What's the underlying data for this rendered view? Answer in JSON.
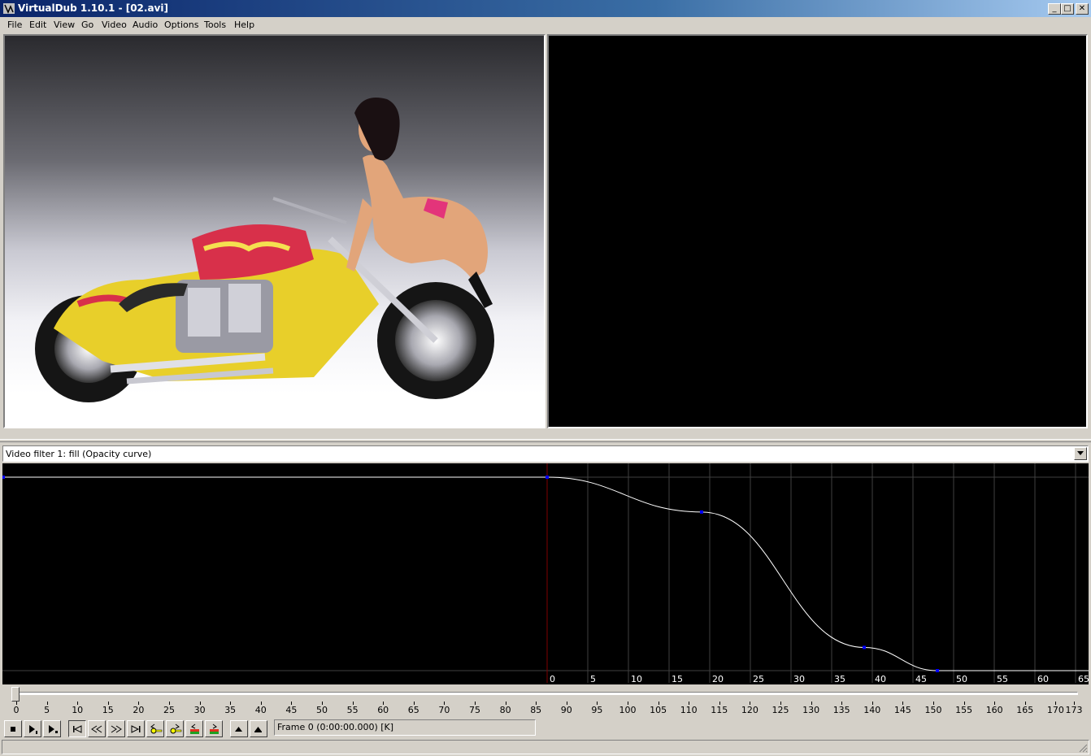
{
  "window": {
    "title": "VirtualDub 1.10.1 - [02.avi]",
    "minimize_glyph": "_",
    "maximize_glyph": "□",
    "close_glyph": "✕"
  },
  "menu": {
    "items": [
      {
        "label": "File"
      },
      {
        "label": "Edit"
      },
      {
        "label": "View"
      },
      {
        "label": "Go"
      },
      {
        "label": "Video"
      },
      {
        "label": "Audio"
      },
      {
        "label": "Options"
      },
      {
        "label": "Tools"
      },
      {
        "label": "Help"
      }
    ]
  },
  "panes": {
    "input_image": "motorcycle-photo",
    "output": "blank"
  },
  "filter_selector": {
    "value": "Video filter 1: fill (Opacity curve)",
    "dropdown_icon": "chevron-down-icon"
  },
  "curve_editor": {
    "frame_labels": [
      "0",
      "5",
      "10",
      "15",
      "20",
      "25",
      "30",
      "35",
      "40",
      "45",
      "50",
      "55",
      "60",
      "65"
    ],
    "keyframes": [
      {
        "frame": 0,
        "value": 1.0
      },
      {
        "frame": 19,
        "value": 0.82
      },
      {
        "frame": 39,
        "value": 0.12
      },
      {
        "frame": 48,
        "value": 0.0
      }
    ],
    "colors": {
      "curve": "#ffffff",
      "point": "#0000ff",
      "current_frame_line": "#800000",
      "grid": "#404040"
    }
  },
  "timeline": {
    "labels": [
      "0",
      "5",
      "10",
      "15",
      "20",
      "25",
      "30",
      "35",
      "40",
      "45",
      "50",
      "55",
      "60",
      "65",
      "70",
      "75",
      "80",
      "85",
      "90",
      "95",
      "100",
      "105",
      "110",
      "115",
      "120",
      "125",
      "130",
      "135",
      "140",
      "145",
      "150",
      "155",
      "160",
      "165",
      "170",
      "173"
    ],
    "current_position": 0
  },
  "toolbar": {
    "buttons": [
      {
        "name": "stop-icon"
      },
      {
        "name": "play-input-icon"
      },
      {
        "name": "play-output-icon"
      },
      {
        "name": "go-start-icon"
      },
      {
        "name": "prev-frame-icon"
      },
      {
        "name": "next-frame-icon"
      },
      {
        "name": "go-end-icon"
      },
      {
        "name": "prev-key-icon"
      },
      {
        "name": "next-key-icon"
      },
      {
        "name": "prev-scene-icon"
      },
      {
        "name": "next-scene-icon"
      },
      {
        "name": "mark-in-icon"
      },
      {
        "name": "mark-out-icon"
      }
    ],
    "frame_status": "Frame 0 (0:00:00.000) [K]"
  }
}
